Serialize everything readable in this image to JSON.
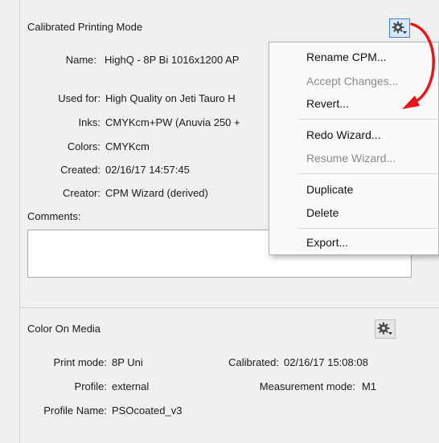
{
  "cpm": {
    "title": "Calibrated Printing Mode",
    "name_label": "Name:",
    "name_value": "HighQ - 8P Bi 1016x1200 AP",
    "used_for_label": "Used for:",
    "used_for_value": "High Quality on Jeti Tauro H",
    "inks_label": "Inks:",
    "inks_value": "CMYKcm+PW (Anuvia 250 +",
    "colors_label": "Colors:",
    "colors_value": "CMYKcm",
    "created_label": "Created:",
    "created_value": "02/16/17 14:57:45",
    "creator_label": "Creator:",
    "creator_value": "CPM Wizard (derived)",
    "comments_label": "Comments:",
    "comments_value": ""
  },
  "menu": {
    "items": [
      {
        "label": "Rename CPM...",
        "enabled": true
      },
      {
        "label": "Accept Changes...",
        "enabled": false
      },
      {
        "label": "Revert...",
        "enabled": true
      },
      {
        "label": "Redo Wizard...",
        "enabled": true
      },
      {
        "label": "Resume Wizard...",
        "enabled": false
      },
      {
        "label": "Duplicate",
        "enabled": true
      },
      {
        "label": "Delete",
        "enabled": true
      },
      {
        "label": "Export...",
        "enabled": true
      }
    ]
  },
  "com": {
    "title": "Color On Media",
    "print_mode_label": "Print mode:",
    "print_mode_value": "8P Uni",
    "calibrated_label": "Calibrated:",
    "calibrated_value": "02/16/17 15:08:08",
    "profile_label": "Profile:",
    "profile_value": "external",
    "measurement_label": "Measurement mode:",
    "measurement_value": "M1",
    "profile_name_label": "Profile Name:",
    "profile_name_value": "PSOcoated_v3"
  },
  "icons": {
    "cpm_gear": "gear-dropdown-icon",
    "com_gear": "gear-dropdown-icon",
    "annotation": "red-curved-arrow"
  },
  "colors": {
    "annotation_red": "#e8161b",
    "active_button_border": "#3c7fd6"
  }
}
